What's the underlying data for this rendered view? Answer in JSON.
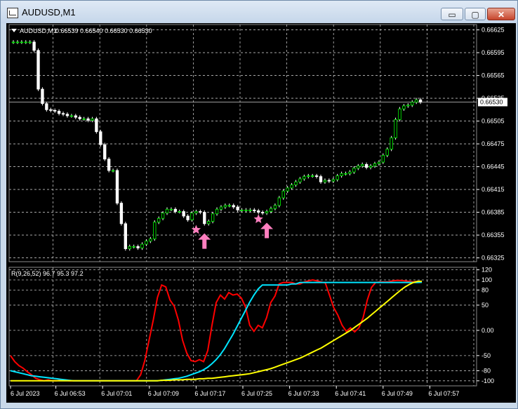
{
  "window": {
    "title": "AUDUSD,M1",
    "icon": "chart-window-icon",
    "controls": {
      "minimize": "▭",
      "maximize": "▢",
      "close": "✕"
    }
  },
  "colors": {
    "background": "#000000",
    "grid": "#bfbfbf",
    "candle": "#ffffff",
    "candle_bull_outline": "#00ff00",
    "indicator_red": "#ff0000",
    "indicator_cyan": "#00e5ff",
    "indicator_yellow": "#ffff00",
    "signal_pink": "#ff7fbf"
  },
  "chart_data": [
    {
      "type": "candlestick",
      "title": "AUDUSD,M1  0.66539 0.66540 0.66530 0.66530",
      "symbol": "AUDUSD,M1",
      "ohlc_header": "0.66539 0.66540 0.66530 0.66530",
      "ylim": [
        0.6632,
        0.66632
      ],
      "price_ticks": [
        "0.66625",
        "0.66595",
        "0.66565",
        "0.66535",
        "0.66505",
        "0.66475",
        "0.66445",
        "0.66415",
        "0.66385",
        "0.66355",
        "0.66325"
      ],
      "current_price": "0.66530",
      "close_series": [
        0.66609,
        0.66609,
        0.66609,
        0.66609,
        0.66609,
        0.66598,
        0.66547,
        0.66528,
        0.6652,
        0.66519,
        0.66518,
        0.66515,
        0.66514,
        0.66512,
        0.66512,
        0.6651,
        0.66508,
        0.66508,
        0.66506,
        0.66508,
        0.66491,
        0.66474,
        0.66455,
        0.6644,
        0.6644,
        0.66397,
        0.6637,
        0.66337,
        0.6634,
        0.6634,
        0.66338,
        0.66343,
        0.66347,
        0.6635,
        0.66372,
        0.66377,
        0.66384,
        0.66389,
        0.66389,
        0.66386,
        0.66386,
        0.6638,
        0.66375,
        0.66384,
        0.66386,
        0.66385,
        0.6637,
        0.66373,
        0.66383,
        0.66389,
        0.66392,
        0.66394,
        0.66394,
        0.66392,
        0.66388,
        0.66388,
        0.66388,
        0.66388,
        0.66387,
        0.66385,
        0.66384,
        0.66386,
        0.6639,
        0.66394,
        0.66404,
        0.66413,
        0.66417,
        0.66421,
        0.66425,
        0.66429,
        0.66432,
        0.66433,
        0.66433,
        0.66432,
        0.66425,
        0.66427,
        0.66426,
        0.66428,
        0.66433,
        0.66436,
        0.66436,
        0.66438,
        0.66443,
        0.66446,
        0.66448,
        0.66444,
        0.66446,
        0.66449,
        0.66451,
        0.6646,
        0.66468,
        0.66483,
        0.66507,
        0.66521,
        0.66525,
        0.66526,
        0.6653,
        0.66533,
        0.6653
      ],
      "signals": [
        {
          "type": "star",
          "price": 0.66362,
          "index": 44
        },
        {
          "type": "arrow-up",
          "price": 0.66348,
          "index": 46
        },
        {
          "type": "star",
          "price": 0.66376,
          "index": 59
        },
        {
          "type": "arrow-up",
          "price": 0.66362,
          "index": 61
        }
      ]
    },
    {
      "type": "line",
      "title": "R(9,26,52) 96.7 95.3 97.2",
      "ylim": [
        -110,
        125
      ],
      "y_ticks": [
        "120",
        "100",
        "80",
        "50",
        "0.00",
        "-50",
        "-80",
        "-100"
      ],
      "x_labels": [
        "6 Jul 2023",
        "6 Jul 06:53",
        "6 Jul 07:01",
        "6 Jul 07:09",
        "6 Jul 07:17",
        "6 Jul 07:25",
        "6 Jul 07:33",
        "6 Jul 07:41",
        "6 Jul 07:49",
        "6 Jul 07:57"
      ],
      "series": [
        {
          "color": "#ff0000",
          "values": [
            -50,
            -62,
            -70,
            -75,
            -82,
            -88,
            -95,
            -98,
            -100,
            -98,
            -100,
            -100,
            -98,
            -99,
            -100,
            -100,
            -100,
            -100,
            -100,
            -100,
            -100,
            -100,
            -100,
            -100,
            -100,
            -100,
            -100,
            -100,
            -100,
            -100,
            -100,
            -88,
            -60,
            -20,
            20,
            65,
            90,
            86,
            60,
            48,
            20,
            -20,
            -45,
            -60,
            -62,
            -58,
            -62,
            -40,
            10,
            55,
            70,
            62,
            75,
            70,
            72,
            64,
            46,
            10,
            -2,
            10,
            5,
            25,
            55,
            68,
            92,
            95,
            95,
            95,
            92,
            92,
            96,
            98,
            100,
            98,
            96,
            94,
            70,
            45,
            30,
            10,
            -2,
            5,
            -3,
            5,
            25,
            60,
            85,
            95,
            96,
            96,
            96,
            98,
            99,
            99,
            98,
            97,
            96,
            97,
            96.7
          ]
        },
        {
          "color": "#00e5ff",
          "values": [
            -80,
            -82,
            -84,
            -86,
            -88,
            -90,
            -91,
            -92,
            -93,
            -94,
            -95,
            -96,
            -97,
            -98,
            -99,
            -100,
            -100,
            -100,
            -100,
            -100,
            -100,
            -100,
            -100,
            -100,
            -100,
            -100,
            -100,
            -100,
            -100,
            -100,
            -100,
            -100,
            -100,
            -100,
            -100,
            -100,
            -99,
            -98,
            -97,
            -96,
            -95,
            -93,
            -91,
            -88,
            -85,
            -82,
            -78,
            -73,
            -66,
            -58,
            -48,
            -36,
            -22,
            -8,
            8,
            24,
            40,
            56,
            70,
            82,
            90,
            90,
            90,
            90,
            90,
            90,
            90,
            92,
            92,
            95,
            95,
            95,
            95,
            95,
            95,
            95,
            95,
            95,
            95,
            95,
            95,
            95,
            95,
            95,
            95,
            95,
            95,
            95,
            95,
            95,
            95,
            95,
            95,
            95,
            95,
            95,
            95,
            95,
            95.3
          ]
        },
        {
          "color": "#ffff00",
          "values": [
            -100,
            -100,
            -100,
            -100,
            -100,
            -100,
            -100,
            -100,
            -100,
            -100,
            -100,
            -100,
            -100,
            -100,
            -100,
            -100,
            -100,
            -100,
            -100,
            -100,
            -100,
            -100,
            -100,
            -100,
            -100,
            -100,
            -100,
            -100,
            -100,
            -100,
            -100,
            -100,
            -100,
            -100,
            -100,
            -100,
            -99,
            -99,
            -99,
            -98,
            -98,
            -98,
            -97,
            -97,
            -97,
            -96,
            -96,
            -95,
            -95,
            -94,
            -93,
            -92,
            -91,
            -90,
            -89,
            -88,
            -87,
            -86,
            -84,
            -82,
            -80,
            -78,
            -76,
            -73,
            -70,
            -67,
            -64,
            -61,
            -58,
            -55,
            -51,
            -47,
            -43,
            -39,
            -35,
            -30,
            -25,
            -20,
            -15,
            -10,
            -5,
            0,
            6,
            12,
            18,
            24,
            31,
            38,
            45,
            52,
            59,
            66,
            73,
            80,
            86,
            91,
            95,
            97,
            97.2
          ]
        }
      ]
    }
  ]
}
